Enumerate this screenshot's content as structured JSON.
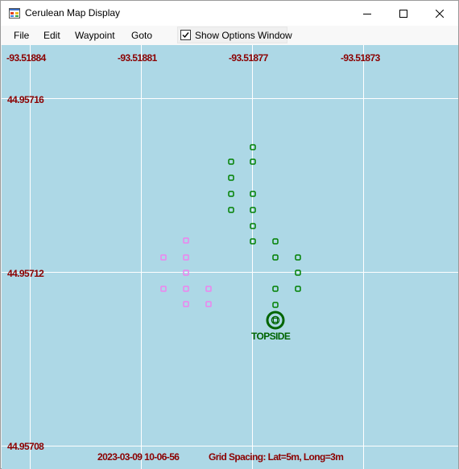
{
  "window": {
    "title": "Cerulean Map Display",
    "controls": {
      "minimize": "minimize-icon",
      "maximize": "maximize-icon",
      "close": "close-icon"
    }
  },
  "menu": {
    "items": [
      "File",
      "Edit",
      "Waypoint",
      "Goto"
    ],
    "show_options": {
      "label": "Show Options Window",
      "checked": true
    }
  },
  "map": {
    "background": "#add8e6",
    "grid_color": "#ffffff",
    "label_color": "#8b0000",
    "longitude_labels": [
      "-93.51884",
      "-93.51881",
      "-93.51877",
      "-93.51873"
    ],
    "latitude_labels": [
      "44.95716",
      "44.95712",
      "44.95708"
    ],
    "topside": {
      "label": "TOPSIDE",
      "color": "#006400"
    },
    "green_waypoint_color": "#008000",
    "pink_waypoint_color": "#ee82ee",
    "status": {
      "timestamp": "2023-03-09  10-06-56",
      "grid_spacing": "Grid Spacing: Lat=5m, Long=3m"
    }
  }
}
